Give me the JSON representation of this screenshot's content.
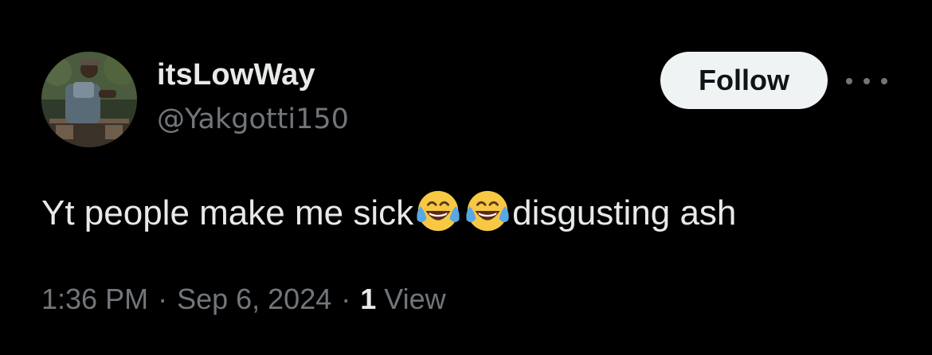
{
  "author": {
    "display_name": "itsLowWay",
    "handle": "@Yakgotti150"
  },
  "actions": {
    "follow_label": "Follow"
  },
  "tweet": {
    "text_part1": "Yt people make me sick",
    "emoji_1": "face-with-tears-of-joy",
    "emoji_2": "face-with-tears-of-joy",
    "text_part2": "disgusting ash"
  },
  "meta": {
    "time": "1:36 PM",
    "separator": "·",
    "date": "Sep 6, 2024",
    "views_count": "1",
    "views_label": "View"
  },
  "colors": {
    "background": "#000000",
    "primary_text": "#e7e9ea",
    "secondary_text": "#71767b",
    "follow_button_bg": "#eff3f4",
    "follow_button_text": "#0f1419"
  }
}
